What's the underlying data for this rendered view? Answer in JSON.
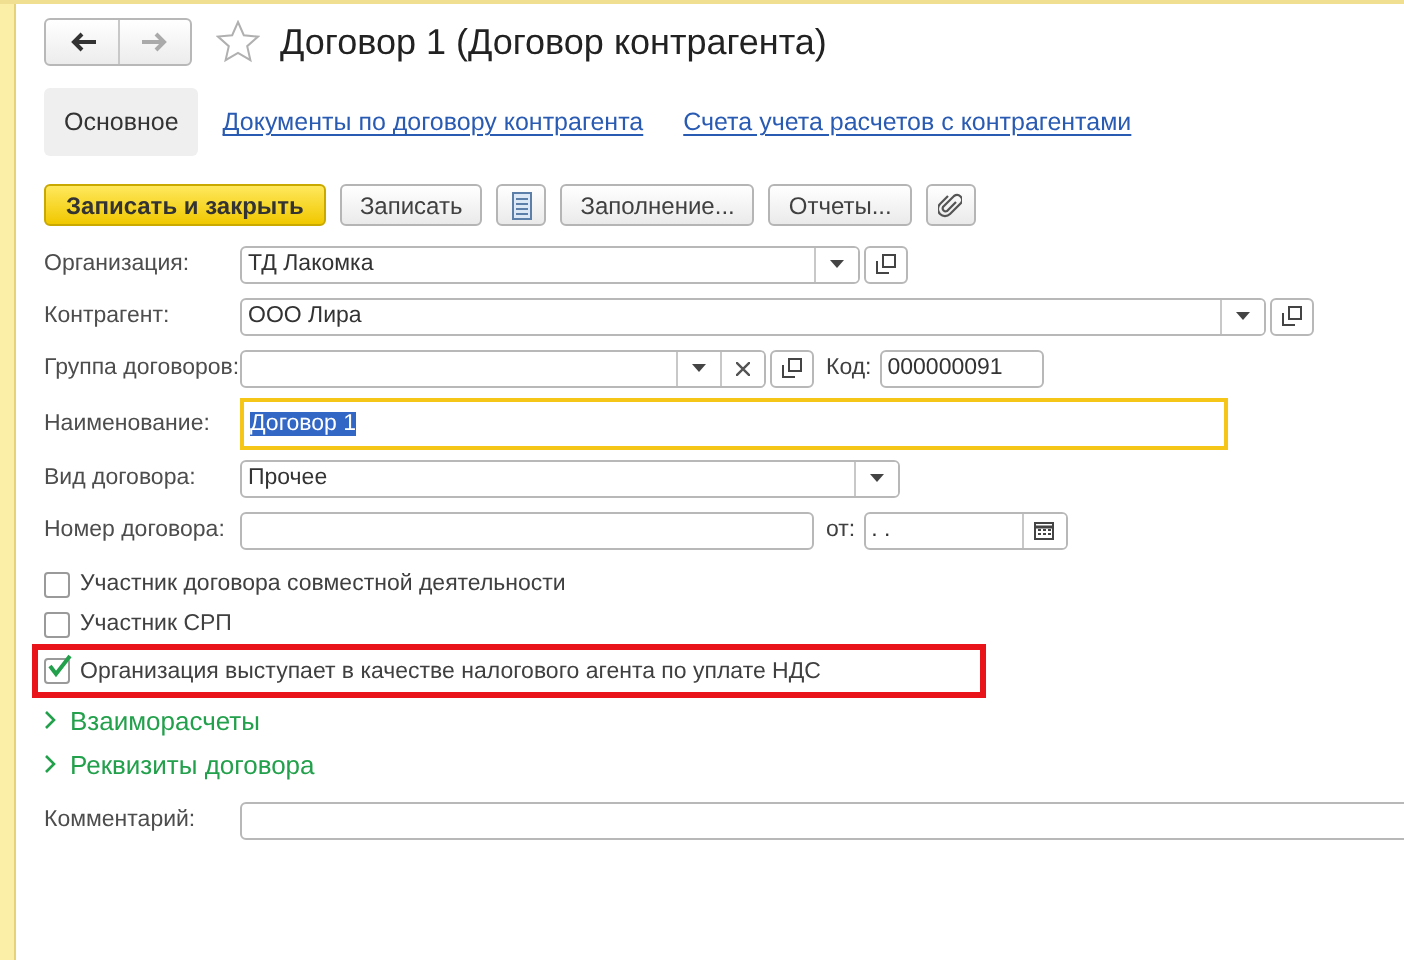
{
  "nav": {
    "back_enabled": true,
    "forward_enabled": false,
    "favorite": false
  },
  "title": "Договор 1 (Договор контрагента)",
  "tabs": [
    {
      "label": "Основное",
      "selected": true
    },
    {
      "label": "Документы по договору контрагента",
      "selected": false
    },
    {
      "label": "Счета учета расчетов с контрагентами",
      "selected": false
    }
  ],
  "toolbar": [
    {
      "kind": "primary",
      "label": "Записать и закрыть"
    },
    {
      "kind": "text",
      "label": "Записать"
    },
    {
      "kind": "list-icon"
    },
    {
      "kind": "text",
      "label": "Заполнение..."
    },
    {
      "kind": "text",
      "label": "Отчеты..."
    },
    {
      "kind": "clip-icon"
    }
  ],
  "fields": [
    {
      "kind": "ref",
      "label": "Организация:",
      "value": "ТД Лакомка",
      "focused": false
    },
    {
      "kind": "ref",
      "label": "Контрагент:",
      "value": "ООО Лира",
      "focused": false
    },
    {
      "kind": "ref-clear",
      "label": "Группа договоров:",
      "focused": false,
      "extra": {
        "label": "Код:",
        "value": "000000091"
      }
    },
    {
      "kind": "text",
      "label": "Наименование:",
      "value": "Договор 1",
      "focused": true
    },
    {
      "kind": "select",
      "label": "Вид договора:",
      "value": "Прочее",
      "focused": false
    },
    {
      "kind": "text",
      "label": "Номер договора:",
      "focused": false,
      "extra": {
        "label": "от:",
        "value": " .  .",
        "kind": "date"
      }
    }
  ],
  "checkboxes": [
    {
      "label": "Участник договора совместной деятельности",
      "checked": false,
      "highlighted": false
    },
    {
      "label": "Участник СРП",
      "checked": false,
      "highlighted": false
    },
    {
      "label": "Организация выступает в качестве налогового агента по уплате НДС",
      "checked": true,
      "highlighted": true
    }
  ],
  "sections": [
    {
      "label": "Взаиморасчеты",
      "expanded": false
    },
    {
      "label": "Реквизиты договора",
      "expanded": false
    }
  ],
  "comment": {
    "label": "Комментарий:"
  }
}
